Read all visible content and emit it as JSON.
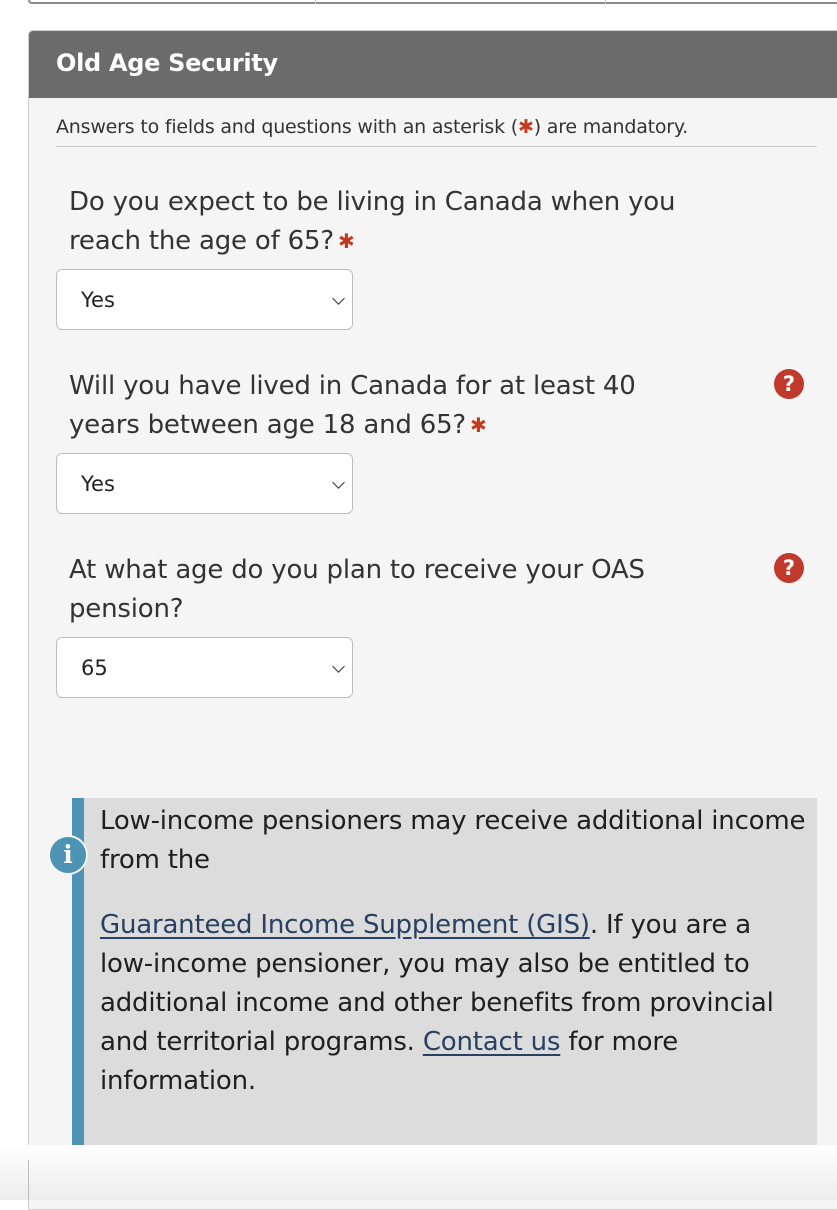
{
  "section": {
    "title": "Old Age Security"
  },
  "mandatory_note": {
    "before": "Answers to fields and questions with an asterisk (",
    "marker": "✱",
    "after": ") are mandatory."
  },
  "questions": [
    {
      "label": "Do you expect to be living in Canada when you reach the age of 65?",
      "required_marker": "✱",
      "selected": "Yes",
      "help_icon": false
    },
    {
      "label": "Will you have lived in Canada for at least 40 years between age 18 and  65?",
      "required_marker": "✱",
      "selected": "Yes",
      "help_icon": true
    },
    {
      "label": "At what age do you plan to receive your OAS pension?",
      "required_marker": "",
      "selected": "65",
      "help_icon": true
    }
  ],
  "help_icon": {
    "glyph": "?",
    "icon": "question-circle-icon",
    "color": "#c0392b"
  },
  "info_box": {
    "icon_glyph": "i",
    "icon": "info-circle-icon",
    "accent_color": "#4d93b3",
    "line1": "Low-income pensioners may receive additional income from the",
    "gis_link": "Guaranteed Income Supplement (GIS)",
    "text_mid": ". If you are a low-income pensioner, you may also be entitled to additional income and other benefits from provincial and territorial programs. ",
    "contact_link": "Contact us",
    "text_end": " for more information."
  },
  "colors": {
    "header_bg": "#6b6b6b",
    "asterisk": "#c23b1f",
    "link": "#284162"
  }
}
